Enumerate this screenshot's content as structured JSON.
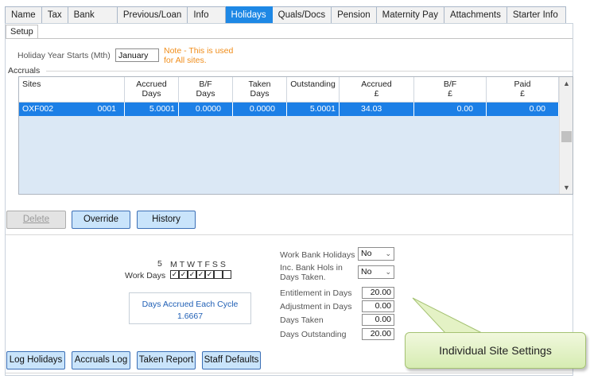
{
  "tabs": [
    "Name",
    "Tax",
    "Bank",
    "Previous/Loan",
    "Info",
    "Holidays",
    "Quals/Docs",
    "Pension",
    "Maternity Pay",
    "Attachments",
    "Starter Info"
  ],
  "active_tab": "Holidays",
  "subtab": "Setup",
  "setup": {
    "holiday_year_label": "Holiday Year Starts (Mth)",
    "holiday_year_value": "January",
    "note": "Note - This is used\nfor All sites."
  },
  "accruals": {
    "label": "Accruals",
    "columns": [
      "Sites",
      "Accrued\nDays",
      "B/F\nDays",
      "Taken\nDays",
      "Outstanding",
      "Accrued\n£",
      "B/F\n£",
      "Paid\n£"
    ],
    "rows": [
      {
        "site": "OXF002",
        "code": "0001",
        "accrued_days": "5.0001",
        "bf_days": "0.0000",
        "taken_days": "0.0000",
        "outstanding": "5.0001",
        "accrued_money": "34.03",
        "bf_money": "0.00",
        "paid_money": "0.00"
      }
    ]
  },
  "buttons": {
    "delete": "Delete",
    "override": "Override",
    "history": "History",
    "log_holidays": "Log Holidays",
    "accruals_log": "Accruals Log",
    "taken_report": "Taken Report",
    "staff_defaults": "Staff Defaults"
  },
  "work_days": {
    "count": "5",
    "label": "Work Days",
    "day_letters": "MTWTFSS",
    "checked": [
      true,
      true,
      true,
      true,
      true,
      false,
      false
    ]
  },
  "cycle": {
    "label": "Days Accrued Each Cycle",
    "value": "1.6667"
  },
  "site_settings": {
    "work_bank_holidays_label": "Work Bank Holidays",
    "work_bank_holidays_value": "No",
    "inc_bank_hols_label": "Inc. Bank Hols in\nDays Taken.",
    "inc_bank_hols_value": "No",
    "entitlement_label": "Entitlement in Days",
    "entitlement_value": "20.00",
    "adjustment_label": "Adjustment in Days",
    "adjustment_value": "0.00",
    "days_taken_label": "Days Taken",
    "days_taken_value": "0.00",
    "days_outstanding_label": "Days Outstanding",
    "days_outstanding_value": "20.00"
  },
  "callout": "Individual Site Settings",
  "colors": {
    "accent": "#1e88e5",
    "note": "#f08d1a",
    "button": "#c9e4fb",
    "callout": "#d6ecb2"
  }
}
